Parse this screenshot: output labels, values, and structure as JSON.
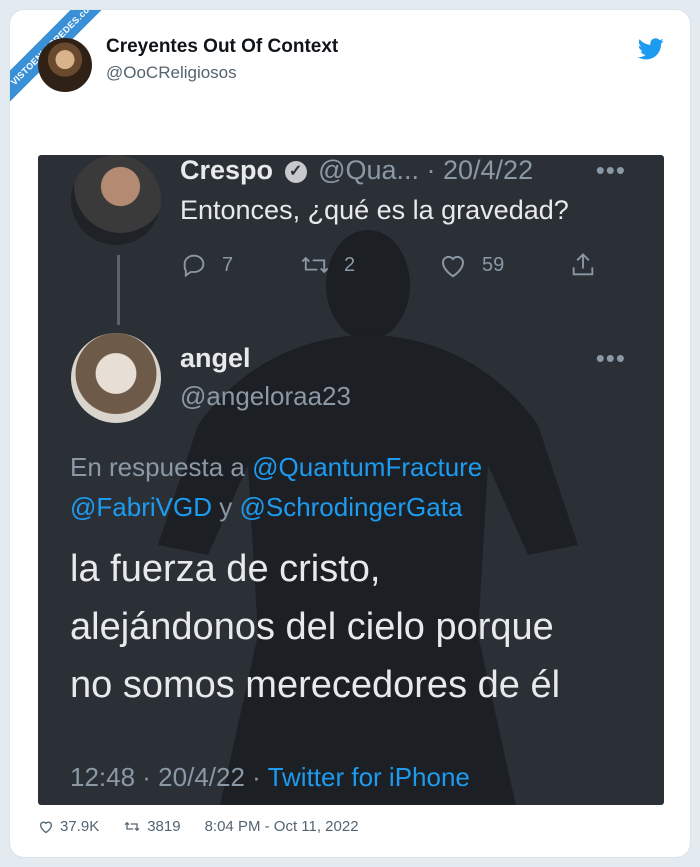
{
  "watermark": "VISTOENLASREDES.com",
  "author": {
    "name": "Creyentes Out Of Context",
    "handle": "@OoCReligiosos"
  },
  "screenshot": {
    "tweet1": {
      "name": "Crespo",
      "handle_date": "@Qua... · 20/4/22",
      "text": "Entonces, ¿qué es la gravedad?",
      "replies": "7",
      "retweets": "2",
      "likes": "59"
    },
    "tweet2": {
      "name": "angel",
      "handle": "@angeloraa23",
      "reply_prefix": "En respuesta a",
      "mention1": "@QuantumFracture",
      "mention2": "@FabriVGD",
      "reply_and": "y",
      "mention3": "@SchrodingerGata",
      "line1": "la fuerza de cristo,",
      "line2": "alejándonos del cielo porque",
      "line3": "no somos merecedores de él",
      "time_date": "12:48 · 20/4/22 ·",
      "source": "Twitter for iPhone"
    }
  },
  "footer": {
    "likes": "37.9K",
    "retweets": "3819",
    "timestamp": "8:04 PM - Oct 11, 2022"
  },
  "colors": {
    "twitter_blue": "#1d9bf0",
    "dark_bg": "#2b3036"
  },
  "icons": [
    "twitter-bird-icon",
    "reply-icon",
    "retweet-icon",
    "heart-icon",
    "share-icon",
    "verified-icon",
    "more-icon"
  ]
}
